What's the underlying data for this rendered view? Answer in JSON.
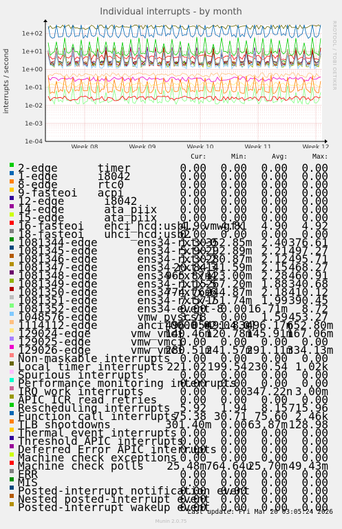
{
  "chart_data": {
    "type": "line",
    "title": "Individual interrupts - by month",
    "ylabel": "interrupts / second",
    "yscale": "log",
    "ylim": [
      0.0001,
      300
    ],
    "y_ticks": [
      "1e-04",
      "1e-03",
      "1e-02",
      "1e-01",
      "1e+00",
      "1e+01",
      "1e+02"
    ],
    "x_ticks": [
      "Week 08",
      "Week 09",
      "Week 10",
      "Week 11",
      "Week 12"
    ],
    "grid": true,
    "columns": [
      "Cur:",
      "Min:",
      "Avg:",
      "Max:"
    ],
    "series": [
      {
        "name": "2-edge      timer",
        "color": "#00cc00",
        "cur": "0.00",
        "min": "0.00",
        "avg": "0.00",
        "max": "0.00"
      },
      {
        "name": "1-edge      i8042",
        "color": "#0066b3",
        "cur": "0.00",
        "min": "0.00",
        "avg": "0.00",
        "max": "0.00"
      },
      {
        "name": "8-edge      rtc0",
        "color": "#ff8000",
        "cur": "0.00",
        "min": "0.00",
        "avg": "0.00",
        "max": "0.00"
      },
      {
        "name": "9-fasteoi   acpi",
        "color": "#ffcc00",
        "cur": "0.00",
        "min": "0.00",
        "avg": "0.00",
        "max": "0.00"
      },
      {
        "name": "12-edge      i8042",
        "color": "#330099",
        "cur": "0.00",
        "min": "0.00",
        "avg": "0.00",
        "max": "0.00"
      },
      {
        "name": "14-edge      ata_piix",
        "color": "#990099",
        "cur": "0.00",
        "min": "0.00",
        "avg": "0.00",
        "max": "0.00"
      },
      {
        "name": "15-edge      ata_piix",
        "color": "#ccff00",
        "cur": "0.00",
        "min": "0.00",
        "avg": "0.00",
        "max": "0.00"
      },
      {
        "name": "16-fasteoi   ehci_hcd:usb1, vmwgfx",
        "color": "#ff0000",
        "cur": "4.90",
        "min": "4.81",
        "avg": "4.90",
        "max": "4.92"
      },
      {
        "name": "18-fasteoi   uhci_hcd:usb2",
        "color": "#808080",
        "cur": "0.00",
        "min": "0.00",
        "avg": "0.00",
        "max": "0.00"
      },
      {
        "name": "1081344-edge      ens34-rxtx-0",
        "color": "#008f00",
        "cur": "1.30",
        "min": "352.85m",
        "avg": "2.40",
        "max": "376.61"
      },
      {
        "name": "1081345-edge      ens34-rxtx-1",
        "color": "#00487d",
        "cur": "5.90",
        "min": "292.89m",
        "avg": "2.21",
        "max": "497.27"
      },
      {
        "name": "1081346-edge      ens34-rxtx-2",
        "color": "#b35a00",
        "cur": "1.30",
        "min": "280.87m",
        "avg": "2.12",
        "max": "495.71"
      },
      {
        "name": "1081347-edge      ens34-rxtx-3",
        "color": "#b38f00",
        "cur": "20.84",
        "min": "141.59m",
        "avg": "2.15",
        "max": "468.27"
      },
      {
        "name": "1081348-edge      ens34-rxtx-4",
        "color": "#6b006b",
        "cur": "965.87m",
        "min": "123.00m",
        "avg": "2.28",
        "max": "460.91"
      },
      {
        "name": "1081349-edge      ens34-rxtx-5",
        "color": "#8fb300",
        "cur": "1.15",
        "min": "267.20m",
        "avg": "1.88",
        "max": "340.68"
      },
      {
        "name": "1081350-edge      ens34-rxtx-6",
        "color": "#b30000",
        "cur": "774.76m",
        "min": "244.87m",
        "avg": "2.18",
        "max": "410.12"
      },
      {
        "name": "1081351-edge      ens34-rxtx-7",
        "color": "#bebebe",
        "cur": "7.57",
        "min": "151.74m",
        "avg": "1.99",
        "max": "390.45"
      },
      {
        "name": "1081352-edge      ens34-event-8",
        "color": "#80ff80",
        "cur": "0.00",
        "min": "0.00",
        "avg": "16.71m",
        "max": "8.72"
      },
      {
        "name": "1048576-edge      vmw_pvscsi",
        "color": "#80c9ff",
        "cur": "3.78",
        "min": "0.00",
        "avg": "1.59",
        "max": "453.27"
      },
      {
        "name": "1114112-edge      ahci[0000:02:04.0]",
        "color": "#ffc080",
        "cur": "496.05m",
        "min": "491.83m",
        "avg": "496.17m",
        "max": "652.80m"
      },
      {
        "name": "129024-edge      vmw_vmci",
        "color": "#ffe680",
        "cur": "140.46m",
        "min": "120.78m",
        "avg": "145.91m",
        "max": "167.06m"
      },
      {
        "name": "129025-edge      vmw_vmci",
        "color": "#aa80ff",
        "cur": "0.00",
        "min": "0.00",
        "avg": "0.00",
        "max": "0.00"
      },
      {
        "name": "129026-edge      vmw_vmci",
        "color": "#ee00cc",
        "cur": "280.51m",
        "min": "241.57m",
        "avg": "291.11m",
        "max": "334.13m"
      },
      {
        "name": "Non-maskable interrupts",
        "color": "#ff8080",
        "cur": "0.00",
        "min": "0.00",
        "avg": "0.00",
        "max": "0.00"
      },
      {
        "name": "Local timer interrupts",
        "color": "#666600",
        "cur": "221.02",
        "min": "199.54",
        "avg": "230.54",
        "max": "1.02k"
      },
      {
        "name": "Spurious interrupts",
        "color": "#ffbfff",
        "cur": "0.00",
        "min": "0.00",
        "avg": "0.00",
        "max": "0.00"
      },
      {
        "name": "Performance monitoring interrupts",
        "color": "#00ffcc",
        "cur": "0.00",
        "min": "0.00",
        "avg": "0.00",
        "max": "0.00"
      },
      {
        "name": "IRQ work interrupts",
        "color": "#cc6699",
        "cur": "0.00",
        "min": "0.00",
        "avg": "347.22n",
        "max": "3.00m"
      },
      {
        "name": "APIC ICR read retries",
        "color": "#999900",
        "cur": "0.00",
        "min": "0.00",
        "avg": "0.00",
        "max": "0.00"
      },
      {
        "name": "Rescheduling interrupts",
        "color": "#00cc00",
        "cur": "5.92",
        "min": "1.94",
        "avg": "8.15",
        "max": "715.96"
      },
      {
        "name": "Function call interrupts",
        "color": "#0066b3",
        "cur": "75.38",
        "min": "30.71",
        "avg": "75.60",
        "max": "2.46k"
      },
      {
        "name": "TLB shootdowns",
        "color": "#ff8000",
        "cur": "301.40m",
        "min": "0.00",
        "avg": "63.87m",
        "max": "128.98"
      },
      {
        "name": "Thermal event interrupts",
        "color": "#ffcc00",
        "cur": "0.00",
        "min": "0.00",
        "avg": "0.00",
        "max": "0.00"
      },
      {
        "name": "Threshold APIC interrupts",
        "color": "#330099",
        "cur": "0.00",
        "min": "0.00",
        "avg": "0.00",
        "max": "0.00"
      },
      {
        "name": "Deferred Error APIC interrupts",
        "color": "#990099",
        "cur": "0.00",
        "min": "0.00",
        "avg": "0.00",
        "max": "0.00"
      },
      {
        "name": "Machine check exceptions",
        "color": "#ccff00",
        "cur": "0.00",
        "min": "0.00",
        "avg": "0.00",
        "max": "0.00"
      },
      {
        "name": "Machine check polls",
        "color": "#ff0000",
        "cur": "25.48m",
        "min": "764.64u",
        "avg": "25.70m",
        "max": "49.43m"
      },
      {
        "name": "ERR",
        "color": "#808080",
        "cur": "0.00",
        "min": "0.00",
        "avg": "0.00",
        "max": "0.00"
      },
      {
        "name": "MIS",
        "color": "#008f00",
        "cur": "0.00",
        "min": "0.00",
        "avg": "0.00",
        "max": "0.00"
      },
      {
        "name": "Posted-interrupt notification event",
        "color": "#00487d",
        "cur": "0.00",
        "min": "0.00",
        "avg": "0.00",
        "max": "0.00"
      },
      {
        "name": "Nested posted-interrupt event",
        "color": "#b35a00",
        "cur": "0.00",
        "min": "0.00",
        "avg": "0.00",
        "max": "0.00"
      },
      {
        "name": "Posted-interrupt wakeup event",
        "color": "#b38f00",
        "cur": "0.00",
        "min": "0.00",
        "avg": "0.00",
        "max": "0.00"
      }
    ]
  },
  "footer": {
    "last_update": "Last update: Fri Mar 20 03:05:24 2026",
    "munin_version": "Munin 2.0.75",
    "rrdtool_credit": "RRDTOOL / TOBI OETIKER"
  }
}
